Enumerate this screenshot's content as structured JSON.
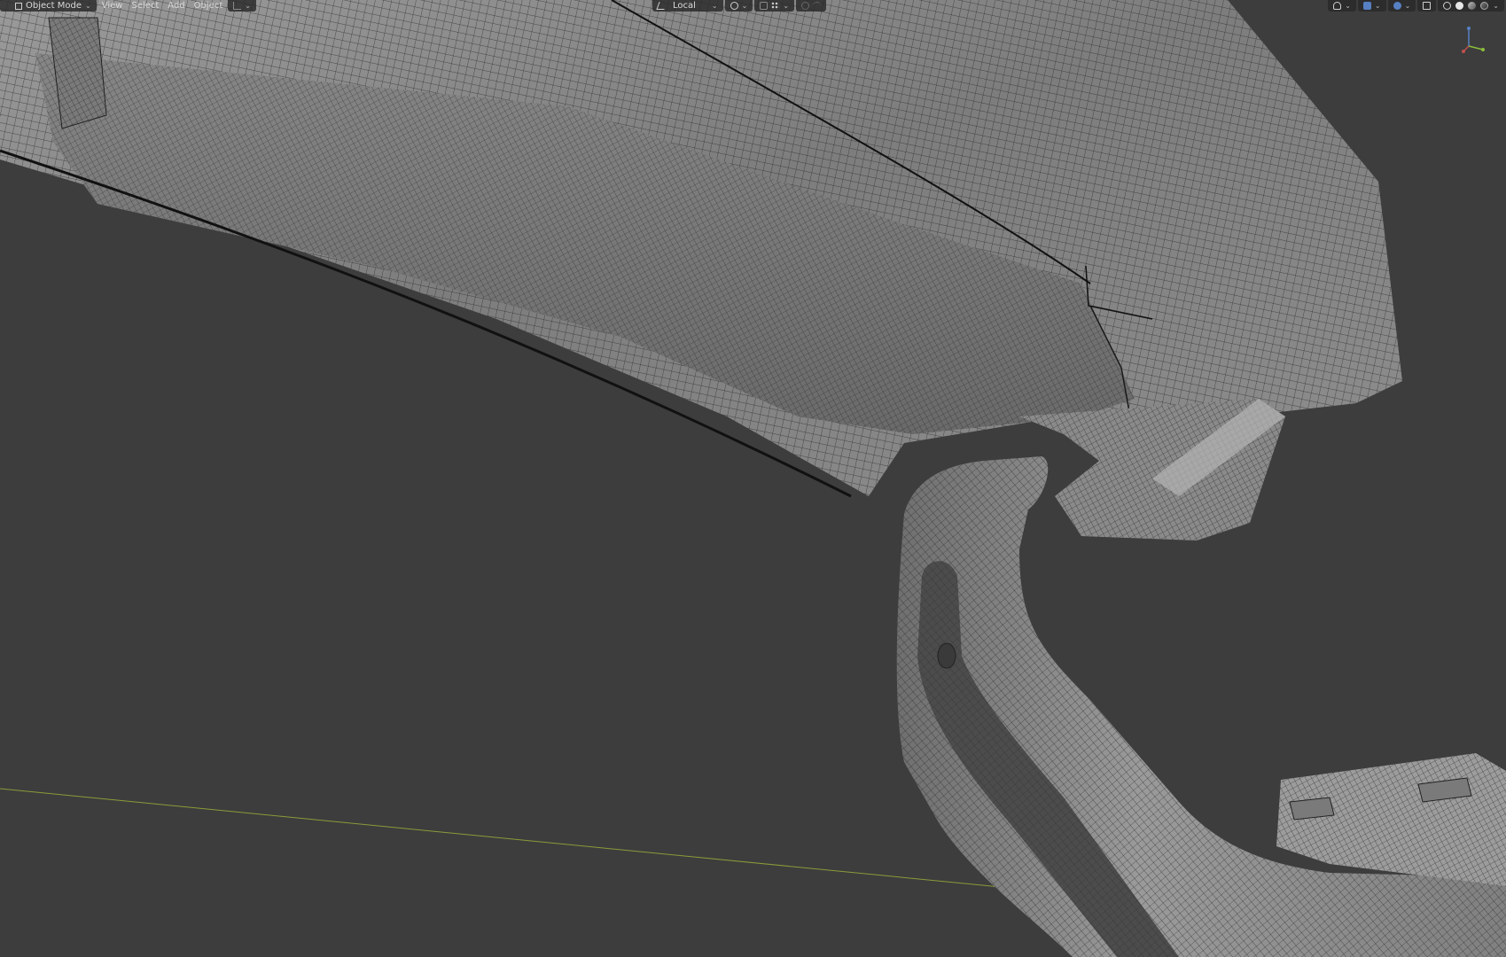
{
  "header": {
    "mode_label": "Object Mode",
    "menus": [
      "View",
      "Select",
      "Add",
      "Object"
    ],
    "transform_orientation": "Local"
  },
  "icons": {
    "mode": "object-mode-icon",
    "selection_mode": "selection-mode-icon",
    "pivot": "pivot-point-icon",
    "snap": "snap-icon",
    "snap_target": "snap-increment-icon",
    "proportional": "proportional-edit-icon",
    "falloff": "falloff-curve-icon",
    "visibility": "visibility-icon",
    "gizmo_toggle": "gizmo-icon",
    "overlay": "overlay-icon",
    "xray": "xray-icon",
    "shading_wire": "wireframe-shading-icon",
    "shading_solid": "solid-shading-icon",
    "shading_material": "material-shading-icon",
    "shading_render": "rendered-shading-icon",
    "nav_gizmo": "axis-gizmo-icon"
  },
  "colors": {
    "viewport_bg": "#3d3d3d",
    "mesh_fill": "#8a8a8a",
    "wire": "#1f1f1f",
    "x_axis": "#8c9b3a",
    "header_bg": "#282828",
    "accent": "#5680c2"
  }
}
